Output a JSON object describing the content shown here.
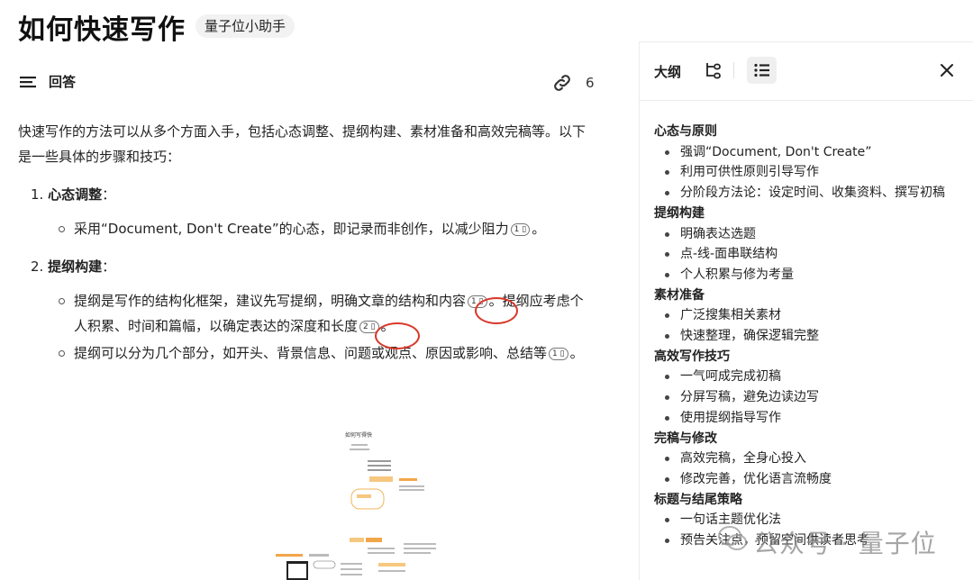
{
  "header": {
    "title": "如何快速写作",
    "author_tag": "量子位小助手"
  },
  "answer": {
    "label": "回答",
    "link_count": "6"
  },
  "content": {
    "intro": "快速写作的方法可以从多个方面入手，包括心态调整、提纲构建、素材准备和高效完稿等。以下是一些具体的步骤和技巧：",
    "items": [
      {
        "number": "1.",
        "title": "心态调整",
        "colon": "：",
        "subs": [
          {
            "text": "采用“Document, Don't Create”的心态，即记录而非创作，以减少阻力",
            "cite": "1",
            "tail": "。"
          }
        ]
      },
      {
        "number": "2.",
        "title": "提纲构建",
        "colon": "：",
        "subs": [
          {
            "text_a": "提纲是写作的结构化框架，建议先写提纲，明确文章的结构和内容",
            "cite_a": "1",
            "text_b": "。提纲应考虑个人积累、时间和篇幅，以确定表达的深度和长度",
            "cite_b": "2",
            "tail": "。"
          },
          {
            "text": "提纲可以分为几个部分，如开头、背景信息、问题或观点、原因或影响、总结等",
            "cite": "1",
            "tail": "。"
          }
        ]
      }
    ]
  },
  "mindmap": {
    "title": "如何写得快"
  },
  "sidebar": {
    "tab_label": "大纲",
    "outline": [
      {
        "section": "心态与原则",
        "items": [
          "强调“Document, Don't Create”",
          "利用可供性原则引导写作",
          "分阶段方法论：设定时间、收集资料、撰写初稿"
        ]
      },
      {
        "section": "提纲构建",
        "items": [
          "明确表达选题",
          "点-线-面串联结构",
          "个人积累与修为考量"
        ]
      },
      {
        "section": "素材准备",
        "items": [
          "广泛搜集相关素材",
          "快速整理，确保逻辑完整"
        ]
      },
      {
        "section": "高效写作技巧",
        "items": [
          "一气呵成完成初稿",
          "分屏写稿，避免边读边写",
          "使用提纲指导写作"
        ]
      },
      {
        "section": "完稿与修改",
        "items": [
          "高效完稿，全身心投入",
          "修改完善，优化语言流畅度"
        ]
      },
      {
        "section": "标题与结尾策略",
        "items": [
          "一句话主题优化法",
          "预告关注点，预留空间供读者思考"
        ]
      }
    ]
  },
  "watermark": {
    "text": "公众号 · 量子位"
  },
  "colors": {
    "accent_red": "#d9382a",
    "text": "#222222",
    "muted": "#888888"
  }
}
